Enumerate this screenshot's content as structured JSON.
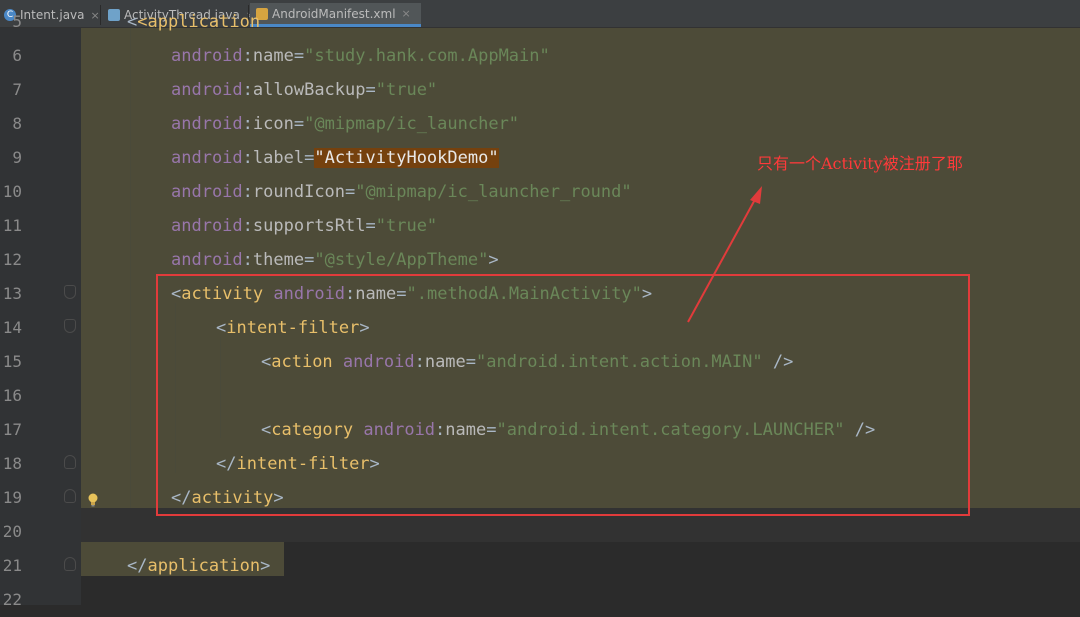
{
  "tabs": [
    {
      "label": "Intent.java",
      "icon": "java-class-icon",
      "color": "#4a88c7"
    },
    {
      "label": "ActivityThread.java",
      "icon": "java-file-icon",
      "color": "#6fa2c9"
    },
    {
      "label": "AndroidManifest.xml",
      "icon": "xml-file-icon",
      "color": "#d6a440",
      "active": true
    }
  ],
  "close_glyph": "×",
  "lines": {
    "n5": "5",
    "n6": "6",
    "n7": "7",
    "n8": "8",
    "n9": "9",
    "n10": "10",
    "n11": "11",
    "n12": "12",
    "n13": "13",
    "n14": "14",
    "n15": "15",
    "n16": "16",
    "n17": "17",
    "n18": "18",
    "n19": "19",
    "n20": "20",
    "n21": "21",
    "n22": "22"
  },
  "code": {
    "l5": "<application",
    "l6": {
      "ns": "android",
      "attr": "name",
      "value": "\"study.hank.com.AppMain\""
    },
    "l7": {
      "ns": "android",
      "attr": "allowBackup",
      "value": "\"true\""
    },
    "l8": {
      "ns": "android",
      "attr": "icon",
      "value": "\"@mipmap/ic_launcher\""
    },
    "l9": {
      "ns": "android",
      "attr": "label",
      "value": "\"ActivityHookDemo\""
    },
    "l10": {
      "ns": "android",
      "attr": "roundIcon",
      "value": "\"@mipmap/ic_launcher_round\""
    },
    "l11": {
      "ns": "android",
      "attr": "supportsRtl",
      "value": "\"true\""
    },
    "l12": {
      "ns": "android",
      "attr": "theme",
      "value": "\"@style/AppTheme\"",
      "close": ">"
    },
    "l13": {
      "tag": "activity",
      "ns": "android",
      "attr": "name",
      "value": "\".methodA.MainActivity\"",
      "close": ">"
    },
    "l14": {
      "tag": "intent-filter",
      "close": ">"
    },
    "l15": {
      "tag": "action",
      "ns": "android",
      "attr": "name",
      "value": "\"android.intent.action.MAIN\"",
      "close": " />"
    },
    "l17": {
      "tag": "category",
      "ns": "android",
      "attr": "name",
      "value": "\"android.intent.category.LAUNCHER\"",
      "close": " />"
    },
    "l18": {
      "tag": "intent-filter"
    },
    "l19": {
      "tag": "activity"
    },
    "l21": {
      "tag": "application"
    }
  },
  "annotation": {
    "text": "只有一个Activity被注册了耶",
    "color": "#e13b3b"
  },
  "colors": {
    "background": "#2b2b2b",
    "highlight": "#4d4b38",
    "tag": "#e8bf6a",
    "namespace": "#9876aa",
    "string": "#6a8759",
    "selection": "#75410e"
  }
}
